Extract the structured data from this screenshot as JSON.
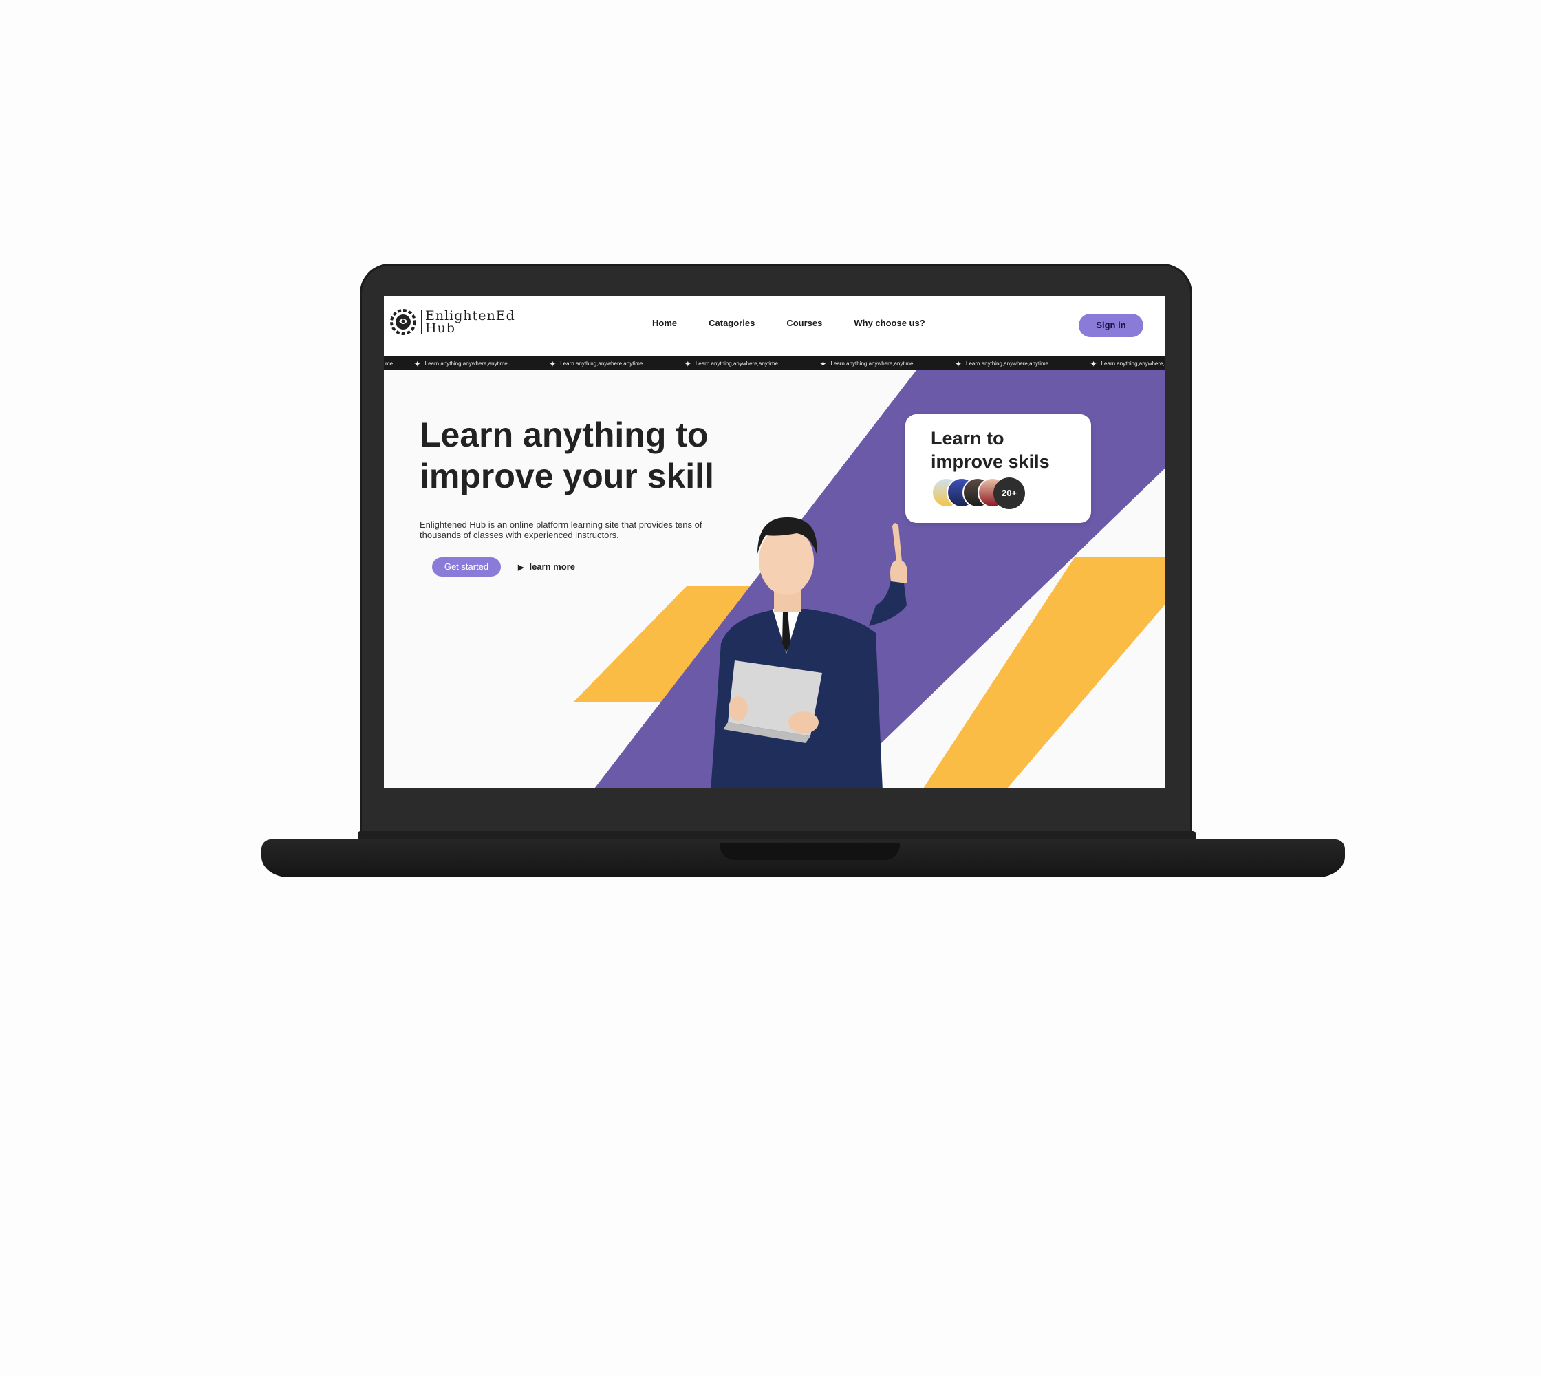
{
  "brand": {
    "name_line1": "EnlightenEd",
    "name_line2": "Hub",
    "logo_icon": "brain-icon"
  },
  "nav": {
    "items": [
      "Home",
      "Catagories",
      "Courses",
      "Why choose us?"
    ],
    "signin_label": "Sign in"
  },
  "ticker": {
    "lead": "me",
    "text": "Learn anything,anywhere,anytime",
    "tail": "Learn anything,anywhere,any",
    "icon": "sparkle-icon"
  },
  "hero": {
    "title": "Learn anything to improve your skill",
    "description": "Enlightened Hub is an online platform learning site that provides tens of thousands of classes with experienced instructors.",
    "cta_primary": "Get started",
    "cta_secondary": "learn more",
    "cta_secondary_icon": "play-icon"
  },
  "card": {
    "title": "Learn to improve skils",
    "avatar_count_label": "20+"
  },
  "colors": {
    "accent": "#8b7bd8",
    "purple": "#6a5aa8",
    "yellow": "#fbbc45",
    "dark": "#222222"
  }
}
